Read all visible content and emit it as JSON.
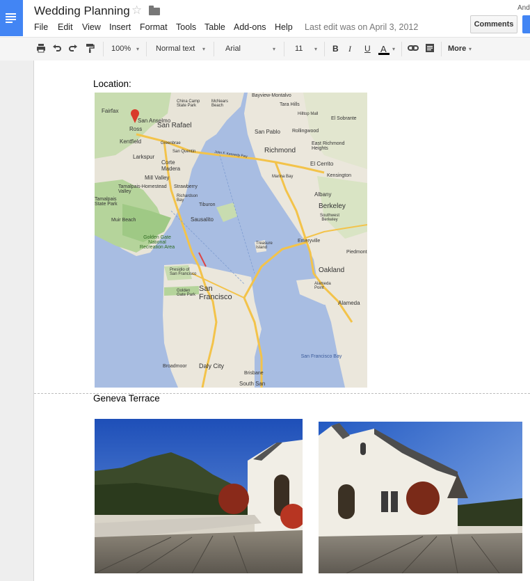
{
  "app": {
    "title": "Wedding Planning",
    "user": "Andr"
  },
  "menu": [
    "File",
    "Edit",
    "View",
    "Insert",
    "Format",
    "Tools",
    "Table",
    "Add-ons",
    "Help"
  ],
  "last_edit": "Last edit was on April 3, 2012",
  "buttons": {
    "comments": "Comments"
  },
  "toolbar": {
    "zoom": "100%",
    "style": "Normal text",
    "font": "Arial",
    "size": "11",
    "bold": "B",
    "italic": "I",
    "underline": "U",
    "text_color": "A",
    "more": "More"
  },
  "document": {
    "location_label": "Location:",
    "venue_label": "Geneva Terrace"
  },
  "map_labels": [
    {
      "text": "Fairfax"
    },
    {
      "text": "San Anselmo"
    },
    {
      "text": "Ross"
    },
    {
      "text": "San Rafael"
    },
    {
      "text": "Kentfield"
    },
    {
      "text": "Greenbrae"
    },
    {
      "text": "San Quentin"
    },
    {
      "text": "Larkspur"
    },
    {
      "text": "Corte Madera"
    },
    {
      "text": "Mill Valley"
    },
    {
      "text": "Tamalpais-Homestead Valley"
    },
    {
      "text": "Strawberry"
    },
    {
      "text": "Richardson Bay"
    },
    {
      "text": "Tiburon"
    },
    {
      "text": "Tamalpais State Park"
    },
    {
      "text": "Muir Beach"
    },
    {
      "text": "Sausalito"
    },
    {
      "text": "Golden Gate National Recreation Area"
    },
    {
      "text": "Presidio of San Francisco"
    },
    {
      "text": "San Francisco"
    },
    {
      "text": "Golden Gate Park"
    },
    {
      "text": "Daly City"
    },
    {
      "text": "Broadmoor"
    },
    {
      "text": "Brisbane"
    },
    {
      "text": "South San"
    },
    {
      "text": "China Camp State Park"
    },
    {
      "text": "McNears Beach"
    },
    {
      "text": "Bayview-Montalvo"
    },
    {
      "text": "Tara Hills"
    },
    {
      "text": "Hilltop Mall"
    },
    {
      "text": "San Pablo"
    },
    {
      "text": "Rollingwood"
    },
    {
      "text": "El Sobrante"
    },
    {
      "text": "Richmond"
    },
    {
      "text": "East Richmond Heights"
    },
    {
      "text": "El Cerrito"
    },
    {
      "text": "Marina Bay"
    },
    {
      "text": "Kensington"
    },
    {
      "text": "Albany"
    },
    {
      "text": "Berkeley"
    },
    {
      "text": "Southwest Berkeley"
    },
    {
      "text": "Emeryville"
    },
    {
      "text": "Piedmont"
    },
    {
      "text": "Oakland"
    },
    {
      "text": "Alameda Point"
    },
    {
      "text": "Alameda"
    },
    {
      "text": "San Francisco Bay"
    },
    {
      "text": "Treasure Island"
    },
    {
      "text": "John F. Kennedy Fwy"
    }
  ]
}
